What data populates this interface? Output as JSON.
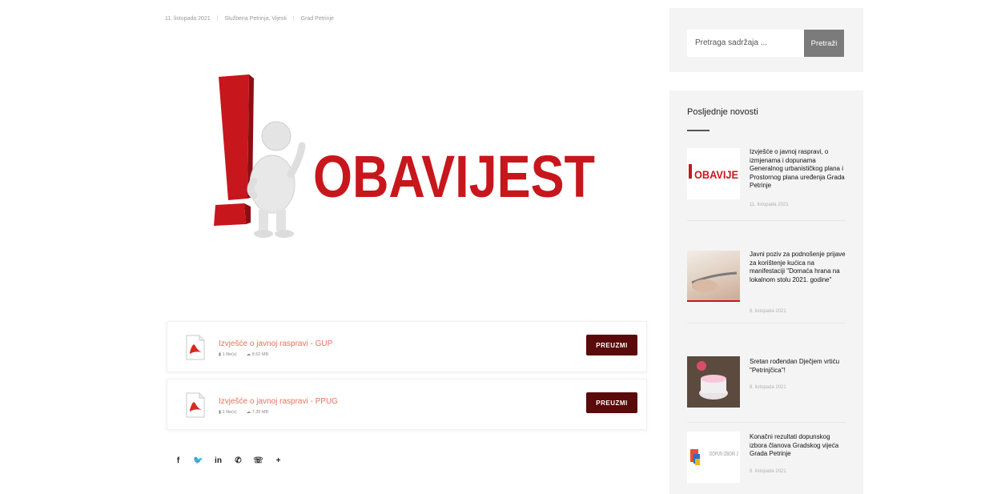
{
  "meta": {
    "date": "11. listopada 2021",
    "sep1": "|",
    "categories": "Službena Petrinja, Vijesti",
    "sep2": "|",
    "author": "Grad Petrinje"
  },
  "hero": {
    "headline": "OBAVIJEST"
  },
  "downloads": [
    {
      "title": "Izvješće o javnoj raspravi - GUP",
      "files": "1 file(s)",
      "size": "8.52 MB",
      "button": "PREUZMI"
    },
    {
      "title": "Izvješće o javnoj raspravi - PPUG",
      "files": "1 file(s)",
      "size": "7.39 MB",
      "button": "PREUZMI"
    }
  ],
  "share": [
    "f",
    "🐦",
    "in",
    "✆",
    "☏",
    "+"
  ],
  "search": {
    "placeholder": "Pretraga sadržaja ...",
    "button": "Pretraži"
  },
  "news": {
    "title": "Posljednje novosti",
    "items": [
      {
        "text": "Izvješće o javnoj raspravi, o izmjenama i dopunama Generalnog urbanističkog plana i Prostornog plana uređenja Grada Petrinje",
        "date": "11. listopada 2021",
        "thumb_text": "OBAVIJE"
      },
      {
        "text": "Javni poziv za podnošenje prijave za korištenje kućica na manifestaciji \"Domaća hrana na lokalnom stolu 2021. godine\"",
        "date": "8. listopada 2021"
      },
      {
        "text": "Sretan rođendan Dječjem vrtiću \"Petrinjčica\"!",
        "date": "8. listopada 2021"
      },
      {
        "text": "Konačni rezultati dopunskog izbora članova Gradskog vijeća Grada Petrinje",
        "date": "8. listopada 2021",
        "thumb_text": "DOPUN IZBORI 2"
      }
    ]
  },
  "colors": {
    "accent": "#e8735a",
    "button_dark": "#5a0a0a",
    "headline_red": "#c8161d"
  }
}
